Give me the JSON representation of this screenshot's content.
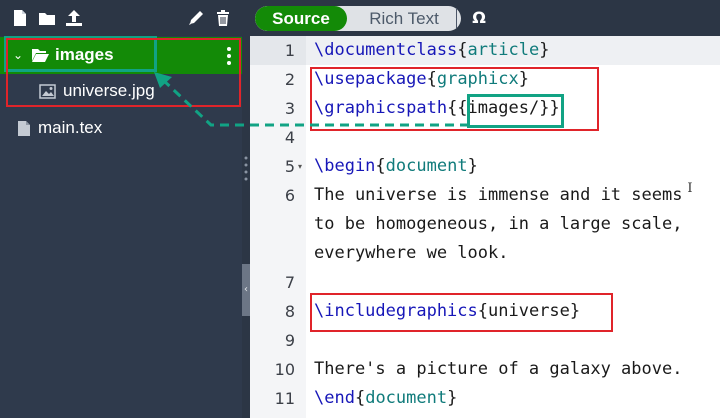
{
  "sidebar": {
    "toolbar": [
      {
        "icon": "new-file-icon"
      },
      {
        "icon": "new-folder-icon"
      },
      {
        "icon": "upload-icon"
      },
      {
        "icon": "rename-icon"
      },
      {
        "icon": "delete-icon"
      }
    ],
    "folder": {
      "label": "images",
      "expanded": true
    },
    "files": [
      {
        "label": "universe.jpg",
        "icon": "image-file-icon"
      },
      {
        "label": "main.tex",
        "icon": "text-file-icon"
      }
    ]
  },
  "editor_toolbar": {
    "source_label": "Source",
    "rich_label": "Rich Text",
    "symbols_label": "Ω"
  },
  "editor": {
    "lines": [
      {
        "num": "1",
        "tokens": [
          {
            "t": "\\documentclass",
            "c": "kw"
          },
          {
            "t": "{",
            "c": "br"
          },
          {
            "t": "article",
            "c": "arg"
          },
          {
            "t": "}",
            "c": "br"
          }
        ]
      },
      {
        "num": "2",
        "tokens": [
          {
            "t": "\\usepackage",
            "c": "kw"
          },
          {
            "t": "{",
            "c": "br"
          },
          {
            "t": "graphicx",
            "c": "arg"
          },
          {
            "t": "}",
            "c": "br"
          }
        ]
      },
      {
        "num": "3",
        "tokens": [
          {
            "t": "\\graphicspath",
            "c": "kw"
          },
          {
            "t": "{{",
            "c": "br"
          },
          {
            "t": "images/",
            "c": ""
          },
          {
            "t": "}}",
            "c": "br"
          }
        ]
      },
      {
        "num": "4",
        "tokens": []
      },
      {
        "num": "5",
        "fold": true,
        "tokens": [
          {
            "t": "\\begin",
            "c": "kw"
          },
          {
            "t": "{",
            "c": "br"
          },
          {
            "t": "document",
            "c": "arg"
          },
          {
            "t": "}",
            "c": "br"
          }
        ]
      },
      {
        "num": "6",
        "tokens": [
          {
            "t": "The universe is immense and it seems",
            "c": ""
          }
        ]
      },
      {
        "num": "",
        "tokens": [
          {
            "t": "to be homogeneous, in a large scale,",
            "c": ""
          }
        ]
      },
      {
        "num": "",
        "tokens": [
          {
            "t": "everywhere we look.",
            "c": ""
          }
        ]
      },
      {
        "num": "7",
        "tokens": []
      },
      {
        "num": "8",
        "tokens": [
          {
            "t": "\\includegraphics",
            "c": "kw"
          },
          {
            "t": "{",
            "c": "br"
          },
          {
            "t": "universe",
            "c": ""
          },
          {
            "t": "}",
            "c": "br"
          }
        ]
      },
      {
        "num": "9",
        "tokens": []
      },
      {
        "num": "10",
        "tokens": [
          {
            "t": "There's a picture of a galaxy above.",
            "c": ""
          }
        ]
      },
      {
        "num": "11",
        "tokens": [
          {
            "t": "\\end",
            "c": "kw"
          },
          {
            "t": "{",
            "c": "br"
          },
          {
            "t": "document",
            "c": "arg"
          },
          {
            "t": "}",
            "c": "br"
          }
        ]
      }
    ]
  },
  "colors": {
    "accent_green": "#138a07",
    "annotation_red": "#e0242a",
    "annotation_teal": "#11a384",
    "keyword": "#1717b8",
    "argument": "#107b7b"
  }
}
